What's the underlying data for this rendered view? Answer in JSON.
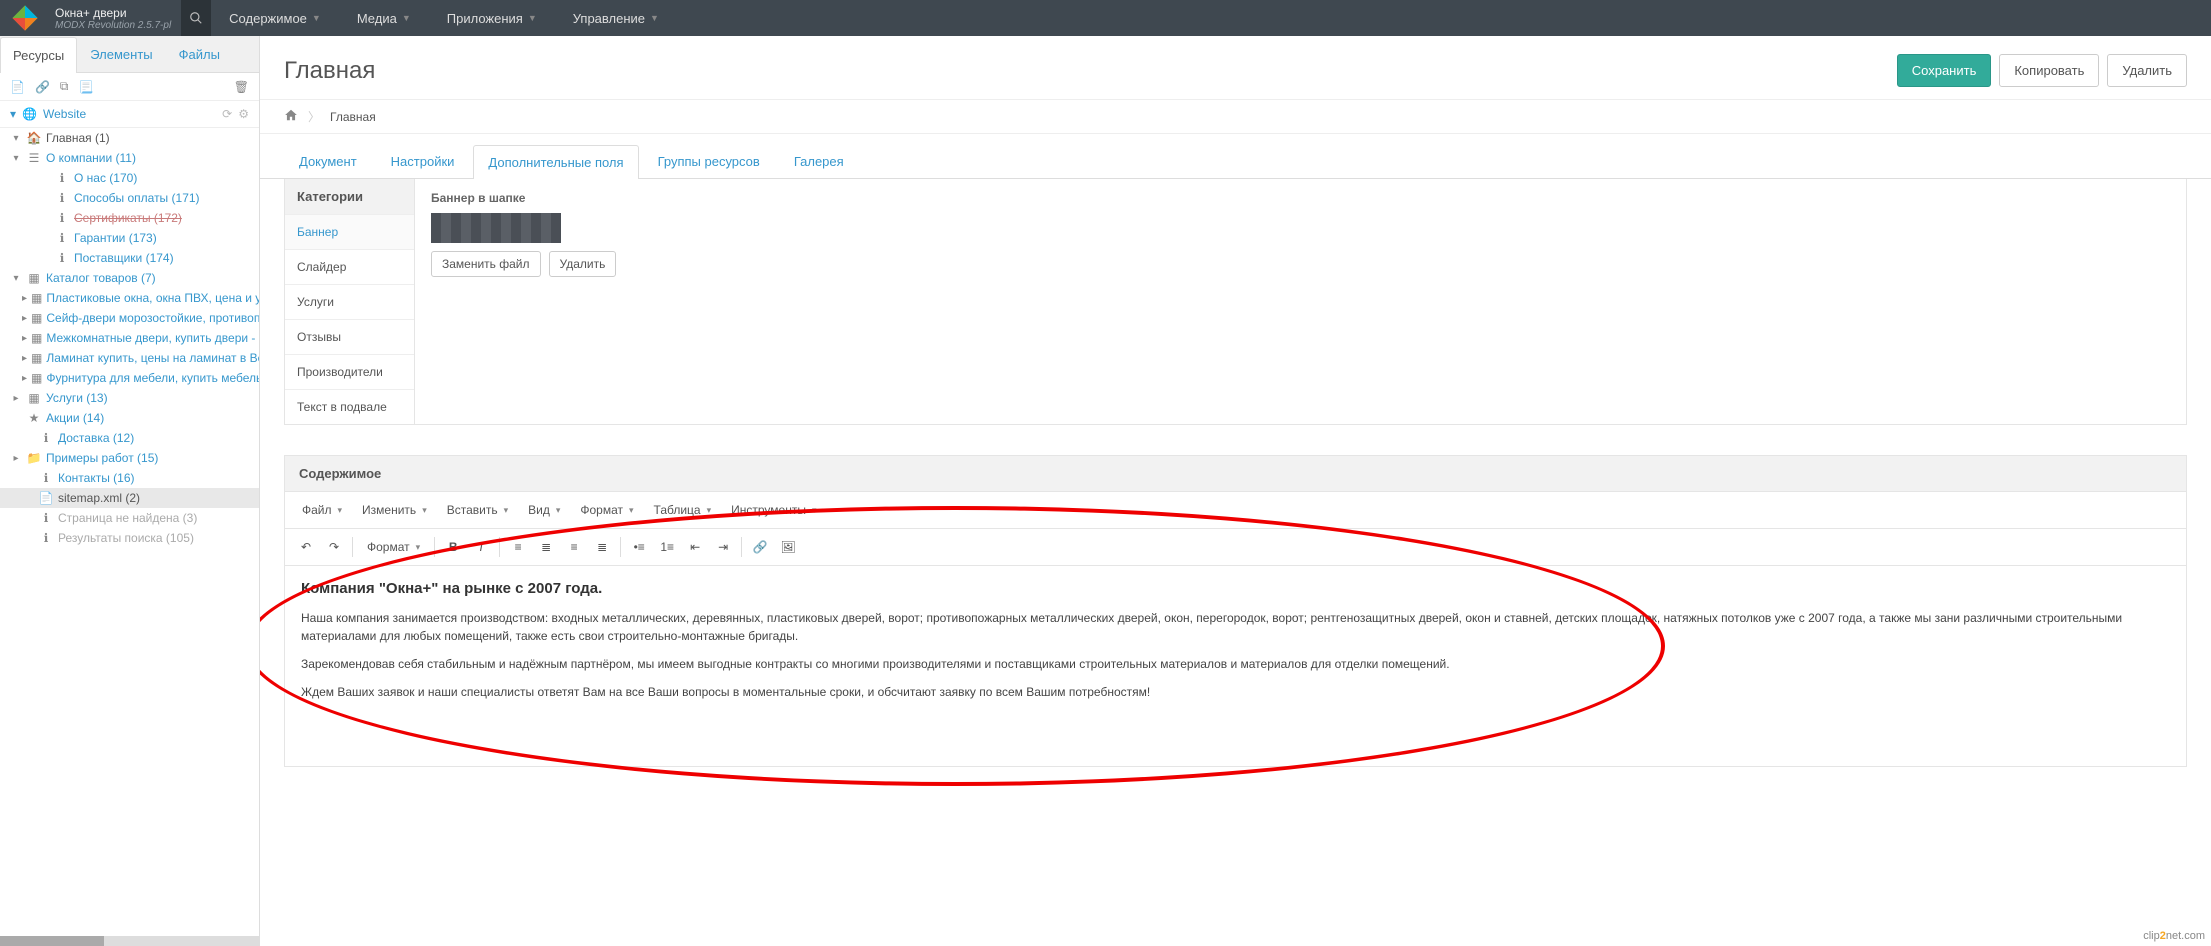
{
  "topbar": {
    "site_name": "Окна+ двери",
    "version": "MODX Revolution 2.5.7-pl",
    "menu": [
      "Содержимое",
      "Медиа",
      "Приложения",
      "Управление"
    ]
  },
  "side_tabs": [
    "Ресурсы",
    "Элементы",
    "Файлы"
  ],
  "context_label": "Website",
  "tree": [
    {
      "label": "Главная (1)",
      "icon": "home",
      "indent": 0,
      "toggle": "▾",
      "link": false
    },
    {
      "label": "О компании (11)",
      "icon": "bars",
      "indent": 0,
      "toggle": "▾",
      "link": true
    },
    {
      "label": "О нас (170)",
      "icon": "info",
      "indent": 2,
      "link": true
    },
    {
      "label": "Способы оплаты (171)",
      "icon": "info",
      "indent": 2,
      "link": true
    },
    {
      "label": "Сертификаты (172)",
      "icon": "info",
      "indent": 2,
      "strike": true
    },
    {
      "label": "Гарантии (173)",
      "icon": "info",
      "indent": 2,
      "link": true
    },
    {
      "label": "Поставщики (174)",
      "icon": "info",
      "indent": 2,
      "link": true
    },
    {
      "label": "Каталог товаров (7)",
      "icon": "grid",
      "indent": 0,
      "toggle": "▾",
      "link": true
    },
    {
      "label": "Пластиковые окна, окна ПВХ, цена и устано...",
      "icon": "grid",
      "indent": 1,
      "toggle": "▸",
      "link": true
    },
    {
      "label": "Сейф-двери морозостойкие, противопожарн...",
      "icon": "grid",
      "indent": 1,
      "toggle": "▸",
      "link": true
    },
    {
      "label": "Межкомнатные двери, купить двери - цена и...",
      "icon": "grid",
      "indent": 1,
      "toggle": "▸",
      "link": true
    },
    {
      "label": "Ламинат купить, цены на ламинат в Верхней...",
      "icon": "grid",
      "indent": 1,
      "toggle": "▸",
      "link": true
    },
    {
      "label": "Фурнитура для мебели, купить мебельную ф...",
      "icon": "grid",
      "indent": 1,
      "toggle": "▸",
      "link": true
    },
    {
      "label": "Услуги (13)",
      "icon": "grid",
      "indent": 0,
      "toggle": "▸",
      "link": true
    },
    {
      "label": "Акции (14)",
      "icon": "star",
      "indent": 0,
      "link": true
    },
    {
      "label": "Доставка (12)",
      "icon": "info",
      "indent": 1,
      "link": true
    },
    {
      "label": "Примеры работ (15)",
      "icon": "folder",
      "indent": 0,
      "toggle": "▸",
      "link": true
    },
    {
      "label": "Контакты (16)",
      "icon": "info",
      "indent": 1,
      "link": true
    },
    {
      "label": "sitemap.xml (2)",
      "icon": "file",
      "indent": 1,
      "selected": true
    },
    {
      "label": "Страница не найдена (3)",
      "icon": "info",
      "indent": 1,
      "muted": true
    },
    {
      "label": "Результаты поиска (105)",
      "icon": "info",
      "indent": 1,
      "muted": true
    }
  ],
  "page": {
    "title": "Главная",
    "actions": {
      "save": "Сохранить",
      "copy": "Копировать",
      "delete": "Удалить"
    },
    "breadcrumb": "Главная"
  },
  "doc_tabs": [
    "Документ",
    "Настройки",
    "Дополнительные поля",
    "Группы ресурсов",
    "Галерея"
  ],
  "doc_tab_active": 2,
  "categories": {
    "header": "Категории",
    "items": [
      "Баннер",
      "Слайдер",
      "Услуги",
      "Отзывы",
      "Производители",
      "Текст в подвале"
    ],
    "active": 0
  },
  "banner": {
    "label": "Баннер в шапке",
    "replace": "Заменить файл",
    "delete": "Удалить"
  },
  "content_section_title": "Содержимое",
  "editor_menus": [
    "Файл",
    "Изменить",
    "Вставить",
    "Вид",
    "Формат",
    "Таблица",
    "Инструменты"
  ],
  "editor_format_label": "Формат",
  "editor_content": {
    "heading": "Компания \"Окна+\" на рынке с 2007 года.",
    "p1": "Наша компания занимается производством: входных металлических, деревянных, пластиковых дверей, ворот; противопожарных металлических дверей, окон, перегородок, ворот; рентгенозащитных дверей, окон и ставней, детских площадок, натяжных потолков уже с 2007 года, а также мы зани различными строительными материалами для любых помещений, также есть свои строительно-монтажные бригады.",
    "p2": "Зарекомендовав себя стабильным и надёжным партнёром, мы имеем выгодные контракты со многими производителями и поставщиками строительных материалов и материалов для отделки помещений.",
    "p3": "Ждем Ваших заявок и наши специалисты ответят Вам на все Ваши вопросы в моментальные сроки, и обсчитают заявку по всем Вашим потребностям!"
  },
  "watermark": "clip2net.com"
}
